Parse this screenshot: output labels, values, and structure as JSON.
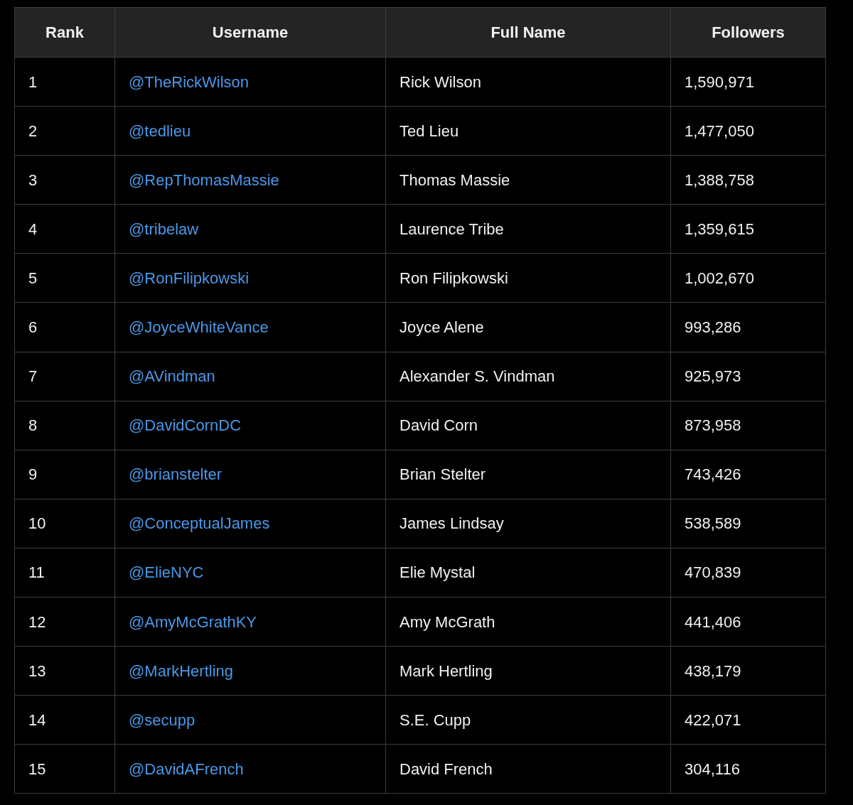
{
  "table": {
    "columns": [
      "Rank",
      "Username",
      "Full Name",
      "Followers"
    ],
    "rows": [
      {
        "rank": "1",
        "username": "@TheRickWilson",
        "full_name": "Rick Wilson",
        "followers": "1,590,971"
      },
      {
        "rank": "2",
        "username": "@tedlieu",
        "full_name": "Ted Lieu",
        "followers": "1,477,050"
      },
      {
        "rank": "3",
        "username": "@RepThomasMassie",
        "full_name": "Thomas Massie",
        "followers": "1,388,758"
      },
      {
        "rank": "4",
        "username": "@tribelaw",
        "full_name": "Laurence Tribe",
        "followers": "1,359,615"
      },
      {
        "rank": "5",
        "username": "@RonFilipkowski",
        "full_name": "Ron Filipkowski",
        "followers": "1,002,670"
      },
      {
        "rank": "6",
        "username": "@JoyceWhiteVance",
        "full_name": "Joyce Alene",
        "followers": "993,286"
      },
      {
        "rank": "7",
        "username": "@AVindman",
        "full_name": "Alexander S. Vindman",
        "followers": "925,973"
      },
      {
        "rank": "8",
        "username": "@DavidCornDC",
        "full_name": "David Corn",
        "followers": "873,958"
      },
      {
        "rank": "9",
        "username": "@brianstelter",
        "full_name": "Brian Stelter",
        "followers": "743,426"
      },
      {
        "rank": "10",
        "username": "@ConceptualJames",
        "full_name": "James Lindsay",
        "followers": "538,589"
      },
      {
        "rank": "11",
        "username": "@ElieNYC",
        "full_name": "Elie Mystal",
        "followers": "470,839"
      },
      {
        "rank": "12",
        "username": "@AmyMcGrathKY",
        "full_name": "Amy McGrath",
        "followers": "441,406"
      },
      {
        "rank": "13",
        "username": "@MarkHertling",
        "full_name": "Mark Hertling",
        "followers": "438,179"
      },
      {
        "rank": "14",
        "username": "@secupp",
        "full_name": "S.E. Cupp",
        "followers": "422,071"
      },
      {
        "rank": "15",
        "username": "@DavidAFrench",
        "full_name": "David French",
        "followers": "304,116"
      }
    ]
  }
}
